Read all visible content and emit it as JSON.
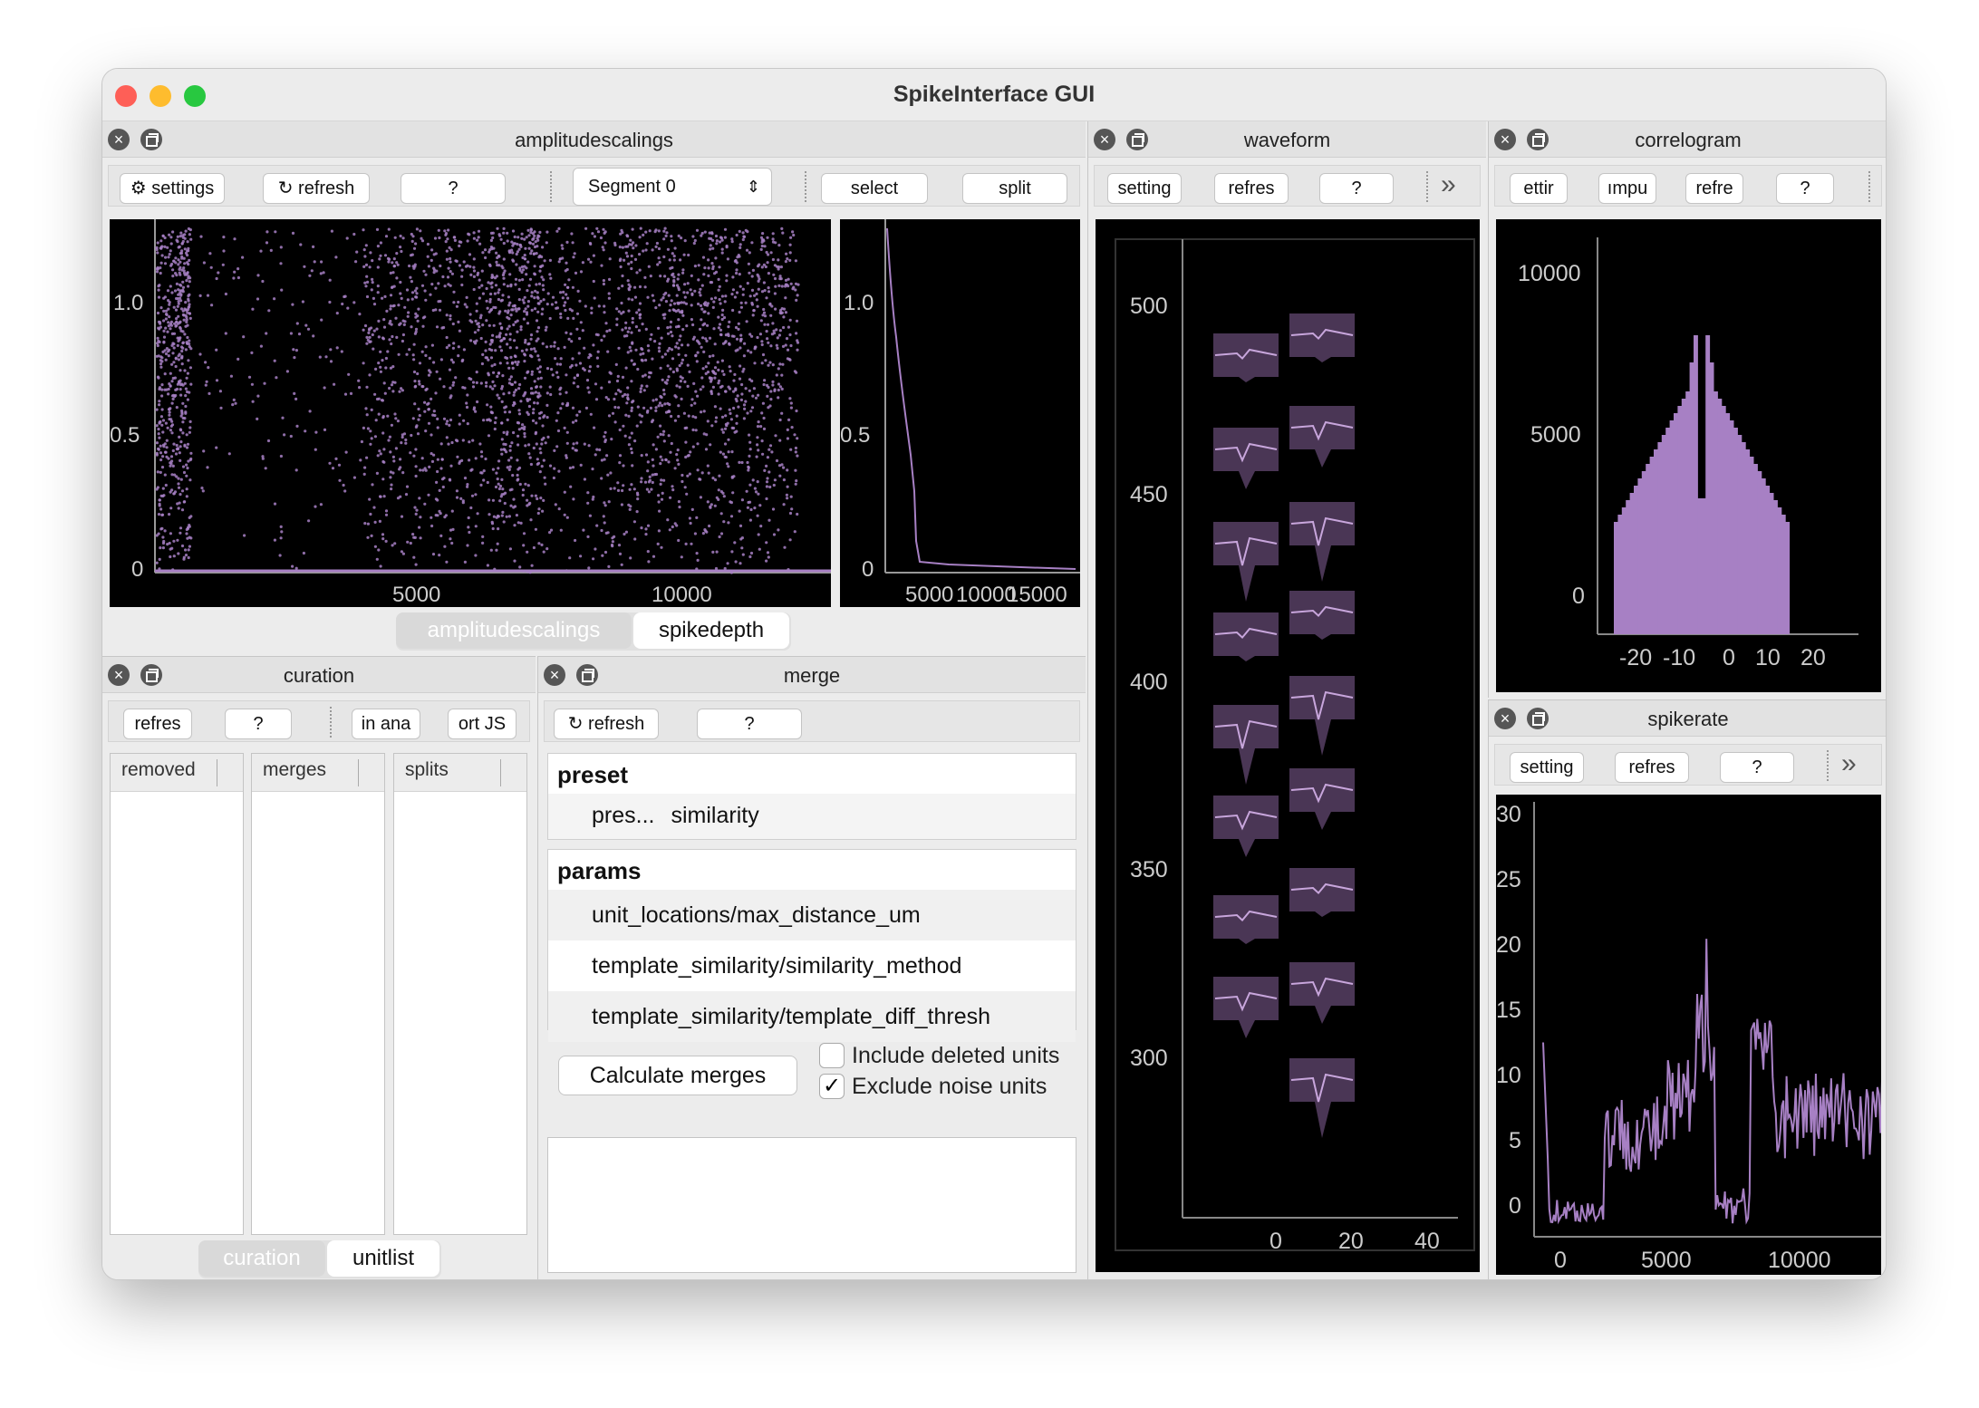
{
  "window": {
    "title": "SpikeInterface GUI"
  },
  "amplitude_dock": {
    "title": "amplitudescalings",
    "settings": "⚙ settings",
    "refresh": "↻ refresh",
    "help": "?",
    "segment": "Segment 0",
    "select": "select",
    "split": "split",
    "tabs": [
      "amplitudescalings",
      "spikedepth"
    ]
  },
  "amp_plot": {
    "yticks": [
      "1.0",
      "0.5",
      "0"
    ],
    "xticks": [
      "5000",
      "10000"
    ]
  },
  "amp_hist": {
    "yticks": [
      "1.0",
      "0.5",
      "0"
    ],
    "xticks": [
      "5000",
      "10000",
      "15000"
    ]
  },
  "waveform_dock": {
    "title": "waveform",
    "settings": "setting",
    "refresh": "refres",
    "help": "?",
    "more": "»",
    "yticks": [
      "500",
      "450",
      "400",
      "350",
      "300"
    ],
    "xticks": [
      "0",
      "20",
      "40"
    ]
  },
  "correlogram_dock": {
    "title": "correlogram",
    "settings": "ettir",
    "compute": "ımpu",
    "refresh": "refre",
    "help": "?",
    "yticks": [
      "10000",
      "5000",
      "0"
    ],
    "xticks": [
      "-20",
      "-10",
      "0",
      "10",
      "20"
    ]
  },
  "spikerate_dock": {
    "title": "spikerate",
    "settings": "setting",
    "refresh": "refres",
    "help": "?",
    "more": "»",
    "yticks": [
      "30",
      "25",
      "20",
      "15",
      "10",
      "5",
      "0"
    ],
    "xticks": [
      "0",
      "5000",
      "10000"
    ]
  },
  "curation_dock": {
    "title": "curation",
    "refresh": "refres",
    "help": "?",
    "analyzer": "in ana",
    "export": "ort JS",
    "columns": [
      "removed",
      "merges",
      "splits"
    ],
    "tabs": [
      "curation",
      "unitlist"
    ]
  },
  "merge_dock": {
    "title": "merge",
    "refresh": "↻ refresh",
    "help": "?",
    "preset": {
      "header": "preset",
      "label": "pres...",
      "value": "similarity"
    },
    "params": {
      "header": "params",
      "rows": [
        "unit_locations/max_distance_um",
        "template_similarity/similarity_method",
        "template_similarity/template_diff_thresh"
      ]
    },
    "calculate": "Calculate merges",
    "include_deleted": "Include deleted units",
    "exclude_noise": "Exclude noise units",
    "include_checked": false,
    "exclude_checked": true
  },
  "colors": {
    "accent": "#a780c4",
    "plot_bg": "#000000",
    "close": "#fe5f57",
    "min": "#febc2e",
    "max": "#28c840"
  }
}
